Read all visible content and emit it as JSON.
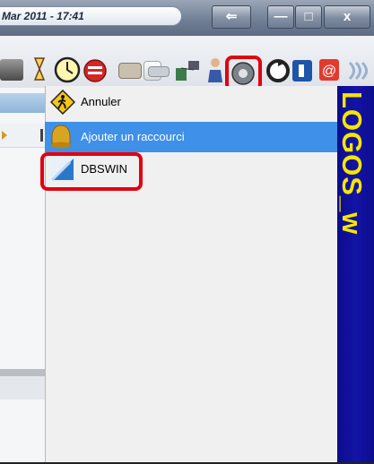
{
  "titlebar": {
    "datetime": "Mar 2011 - 17:41",
    "minimize_label": "—",
    "maximize_label": "□",
    "close_label": "x",
    "nav_label": "⇐"
  },
  "toolbar": {
    "icons": [
      "hourglass-icon",
      "clock-icon",
      "agenda-icon",
      "card-icon",
      "document-icon",
      "scanner-icon",
      "network-icon",
      "person-icon",
      "blank-disc-icon",
      "refresh-icon",
      "phone-icon",
      "email-icon",
      "wave-icon"
    ]
  },
  "menu": {
    "items": [
      {
        "label": "Annuler",
        "icon": "pedestrian-sign-icon"
      },
      {
        "label": "Ajouter un raccourci",
        "icon": "bell-icon"
      },
      {
        "label": "DBSWIN",
        "icon": "dbswin-logo-icon"
      }
    ]
  },
  "banner": {
    "text": "LOGOS_w"
  },
  "colors": {
    "selection": "#3e90e8",
    "highlight": "#e3000f",
    "banner_bg": "#1313a8",
    "banner_text": "#f4e600"
  }
}
